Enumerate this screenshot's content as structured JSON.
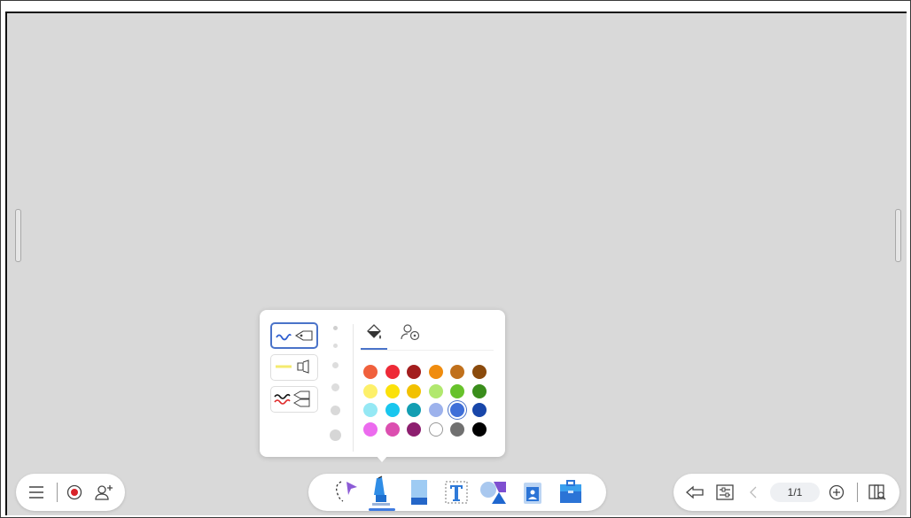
{
  "canvas": {
    "background": "#d9d9d9"
  },
  "left_toolbar": {
    "items": [
      {
        "name": "menu-icon"
      },
      {
        "name": "record-icon"
      },
      {
        "name": "add-user-icon"
      }
    ]
  },
  "center_toolbar": {
    "active_tool": "pen",
    "tools": [
      "lasso-select",
      "pen",
      "eraser",
      "text",
      "shapes",
      "insert-image",
      "toolbox"
    ]
  },
  "right_toolbar": {
    "page_indicator": "1/1"
  },
  "pen_popup": {
    "pen_types": [
      "fountain-pen",
      "highlighter",
      "multicolor-pen"
    ],
    "selected_pen": "fountain-pen",
    "tabs": [
      "fill-color",
      "custom-color"
    ],
    "active_tab": "fill-color",
    "selected_color": "#3f6fd8",
    "colors": [
      [
        "#f0603c",
        "#ee2a37",
        "#a31d1d",
        "#f08c0e",
        "#c0701c",
        "#8a4a0c"
      ],
      [
        "#fdf06a",
        "#fbe10a",
        "#f2c100",
        "#b1e86e",
        "#67c22b",
        "#3a8d1c"
      ],
      [
        "#95e8f4",
        "#19c6ee",
        "#139eb2",
        "#9db2ec",
        "#3f6fd8",
        "#1846a9"
      ],
      [
        "#ec6bee",
        "#dc4fb0",
        "#8d1f6f",
        "#ffffff",
        "#707070",
        "#000000"
      ]
    ]
  }
}
